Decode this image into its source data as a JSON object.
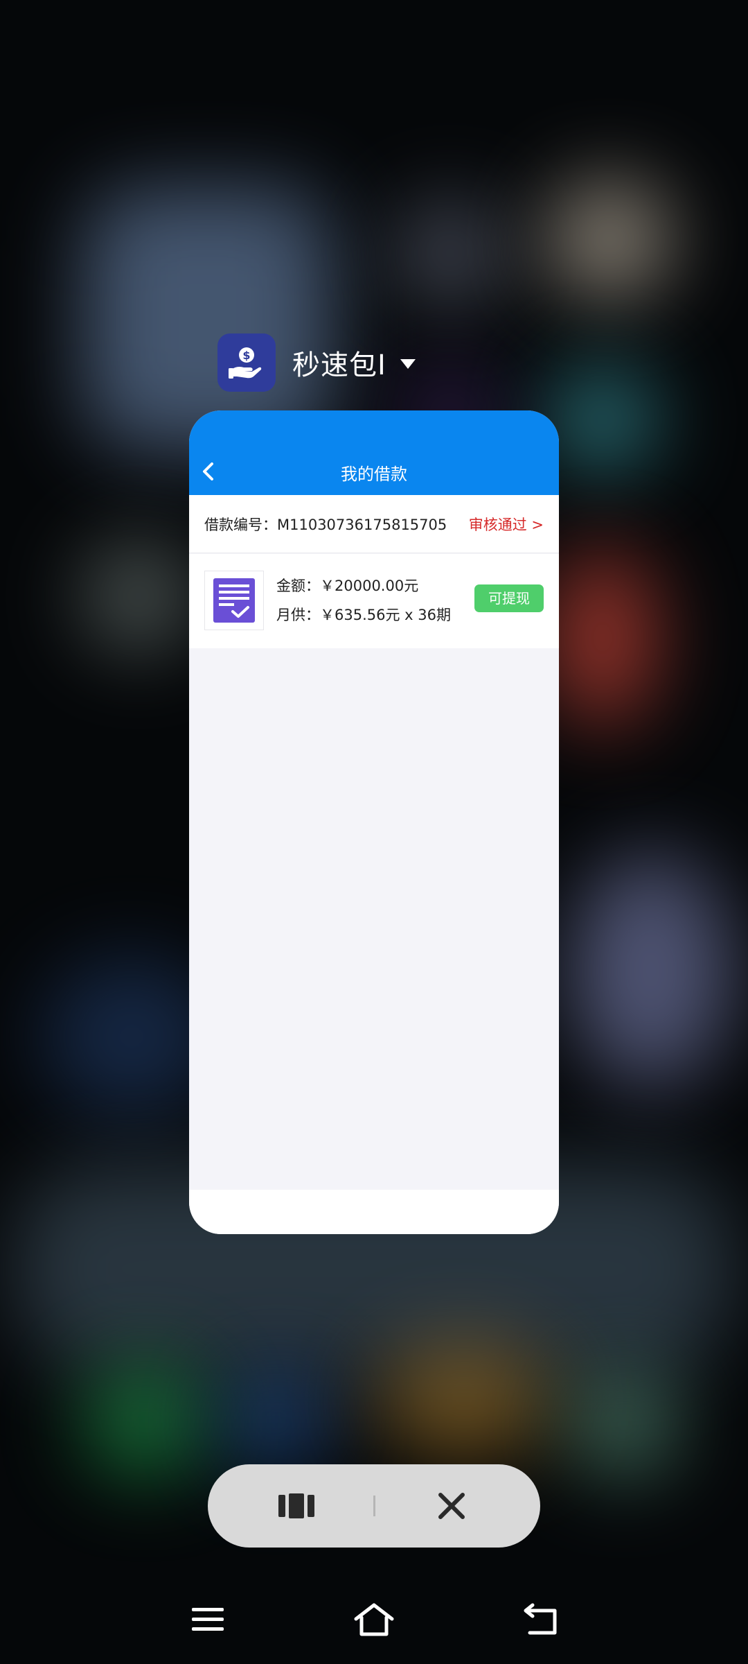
{
  "app_switcher": {
    "app_name": "秒速包I"
  },
  "app_screen": {
    "title": "我的借款",
    "loan_number": "借款编号：M11030736175815705",
    "loan_status": "审核通过 >",
    "amount": "金额：￥20000.00元",
    "monthly_payment": "月供：￥635.56元 x 36期",
    "withdraw_button": "可提现"
  },
  "colors": {
    "topbar": "#0a86ef",
    "status_red": "#d62a2a",
    "withdraw_green": "#4fce6b",
    "app_icon_bg": "#2f3c9b"
  },
  "icons": {
    "app_icon": "hand-holding-coin-icon",
    "back": "chevron-left-icon",
    "document": "document-check-icon",
    "view_mode": "columns-icon",
    "close": "close-icon",
    "menu": "menu-icon",
    "home": "home-icon",
    "back_nav": "back-arrow-icon"
  }
}
